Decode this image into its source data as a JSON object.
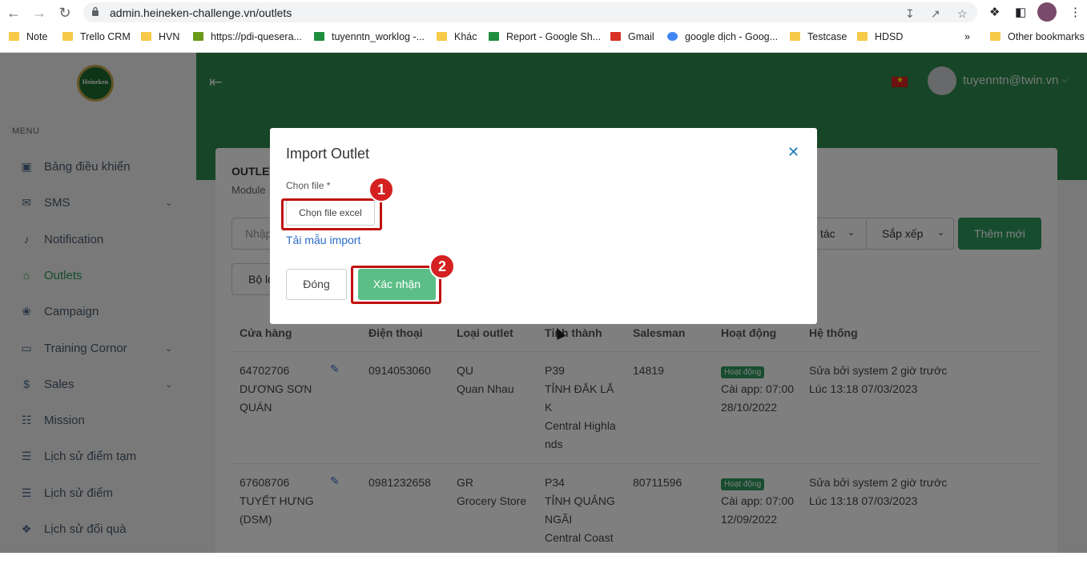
{
  "browser": {
    "url": "admin.heineken-challenge.vn/outlets",
    "bookmarks": [
      "Note",
      "Trello CRM",
      "HVN",
      "https://pdi-quesera...",
      "tuyenntn_worklog -...",
      "Khác",
      "Report - Google Sh...",
      "Gmail",
      "google dịch - Goog...",
      "Testcase",
      "HDSD"
    ],
    "overflow": "»",
    "other_bookmarks": "Other bookmarks"
  },
  "sidebar": {
    "logo_text": "Heineken",
    "menu_label": "MENU",
    "items": [
      {
        "label": "Bảng điều khiển",
        "icon": "dashboard-icon",
        "expandable": false,
        "active": false
      },
      {
        "label": "SMS",
        "icon": "mail-icon",
        "expandable": true,
        "active": false
      },
      {
        "label": "Notification",
        "icon": "bell-icon",
        "expandable": false,
        "active": false
      },
      {
        "label": "Outlets",
        "icon": "store-icon",
        "expandable": false,
        "active": true
      },
      {
        "label": "Campaign",
        "icon": "campaign-icon",
        "expandable": false,
        "active": false
      },
      {
        "label": "Training Cornor",
        "icon": "monitor-icon",
        "expandable": true,
        "active": false
      },
      {
        "label": "Sales",
        "icon": "sales-icon",
        "expandable": true,
        "active": false
      },
      {
        "label": "Mission",
        "icon": "clipboard-icon",
        "expandable": false,
        "active": false
      },
      {
        "label": "Lịch sử điểm tạm",
        "icon": "history-icon",
        "expandable": false,
        "active": false
      },
      {
        "label": "Lịch sử điểm",
        "icon": "history-icon",
        "expandable": false,
        "active": false
      },
      {
        "label": "Lịch sử đổi quà",
        "icon": "gift-icon",
        "expandable": false,
        "active": false
      }
    ]
  },
  "header": {
    "user": "tuyenntn@twin.vn"
  },
  "page": {
    "title": "OUTLET",
    "subtitle": "Module",
    "search_placeholder": "Nhập",
    "action_btn": "tác",
    "sort_btn": "Sắp xếp",
    "add_btn": "Thêm mới",
    "filter_btn": "Bộ lọ"
  },
  "table": {
    "headers": [
      "Cửa hàng",
      "Điện thoại",
      "Loại outlet",
      "Tỉnh thành",
      "Salesman",
      "Hoạt động",
      "Hệ thống"
    ],
    "rows": [
      {
        "code": "64702706",
        "name_l1": "DƯƠNG SƠN",
        "name_l2": "QUÁN",
        "phone": "0914053060",
        "type_code": "QU",
        "type_name": "Quan Nhau",
        "p_code": "P39",
        "p_l1": "TỈNH ĐẮK LẮ",
        "p_l2": "K",
        "p_l3": "Central Highla",
        "p_l4": "nds",
        "salesman": "14819",
        "status": "Hoạt động",
        "app_l1": "Cài app: 07:00",
        "app_l2": "28/10/2022",
        "sys_l1": "Sửa bởi system 2 giờ trước",
        "sys_l2": "Lúc 13:18 07/03/2023"
      },
      {
        "code": "67608706",
        "name_l1": "TUYẾT HƯNG",
        "name_l2": "(DSM)",
        "phone": "0981232658",
        "type_code": "GR",
        "type_name": "Grocery Store",
        "p_code": "P34",
        "p_l1": "TỈNH QUẢNG",
        "p_l2": "NGÃI",
        "p_l3": "Central Coast",
        "p_l4": "",
        "salesman": "80711596",
        "status": "Hoạt động",
        "app_l1": "Cài app: 07:00",
        "app_l2": "12/09/2022",
        "sys_l1": "Sửa bởi system 2 giờ trước",
        "sys_l2": "Lúc 13:18 07/03/2023"
      }
    ]
  },
  "modal": {
    "title": "Import Outlet",
    "close_icon": "close-icon",
    "file_label": "Chọn file *",
    "file_button": "Chọn file excel",
    "template_link": "Tải mẫu import",
    "close_button": "Đóng",
    "confirm_button": "Xác nhận"
  },
  "callouts": {
    "first": "1",
    "second": "2"
  },
  "colors": {
    "brand_green": "#2e8a4e",
    "confirm_green": "#5bbe86",
    "callout_red": "#c01010"
  }
}
